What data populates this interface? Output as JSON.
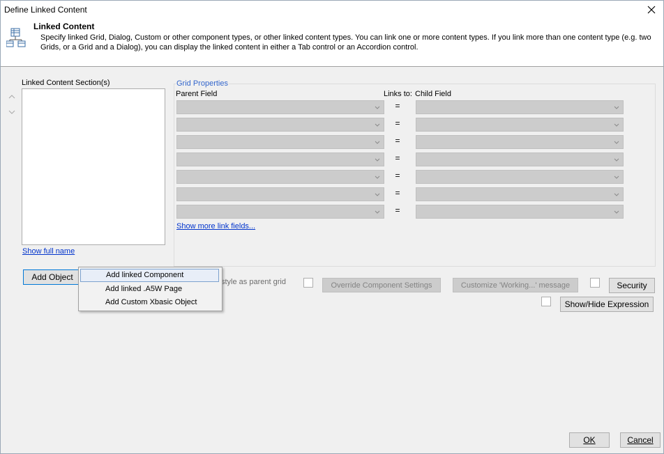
{
  "window": {
    "title": "Define Linked Content"
  },
  "header": {
    "title": "Linked Content",
    "description": "Specify linked Grid, Dialog, Custom or other component types, or other linked content types. You can link one or more content types. If you link more than one content type (e.g. two Grids, or a Grid and a Dialog), you can display the linked content in either a Tab control or an Accordion control."
  },
  "sections": {
    "label": "Linked Content Section(s)",
    "show_full_name": "Show full name"
  },
  "grid_properties": {
    "label": "Grid Properties",
    "parent_field_label": "Parent Field",
    "links_to_label": "Links to:",
    "child_field_label": "Child Field",
    "equals": "=",
    "rows": [
      {
        "parent": "",
        "child": ""
      },
      {
        "parent": "",
        "child": ""
      },
      {
        "parent": "",
        "child": ""
      },
      {
        "parent": "",
        "child": ""
      },
      {
        "parent": "",
        "child": ""
      },
      {
        "parent": "",
        "child": ""
      },
      {
        "parent": "",
        "child": ""
      }
    ],
    "show_more": "Show more link fields..."
  },
  "buttons": {
    "add_object": "Add Object",
    "override": "Override Component Settings",
    "customize": "Customize 'Working...' message",
    "security": "Security",
    "show_hide": "Show/Hide Expression",
    "ok": "OK",
    "cancel": "Cancel"
  },
  "style_label": "style as parent grid",
  "menu": {
    "items": [
      "Add linked Component",
      "Add linked .A5W Page",
      "Add Custom Xbasic Object"
    ]
  }
}
